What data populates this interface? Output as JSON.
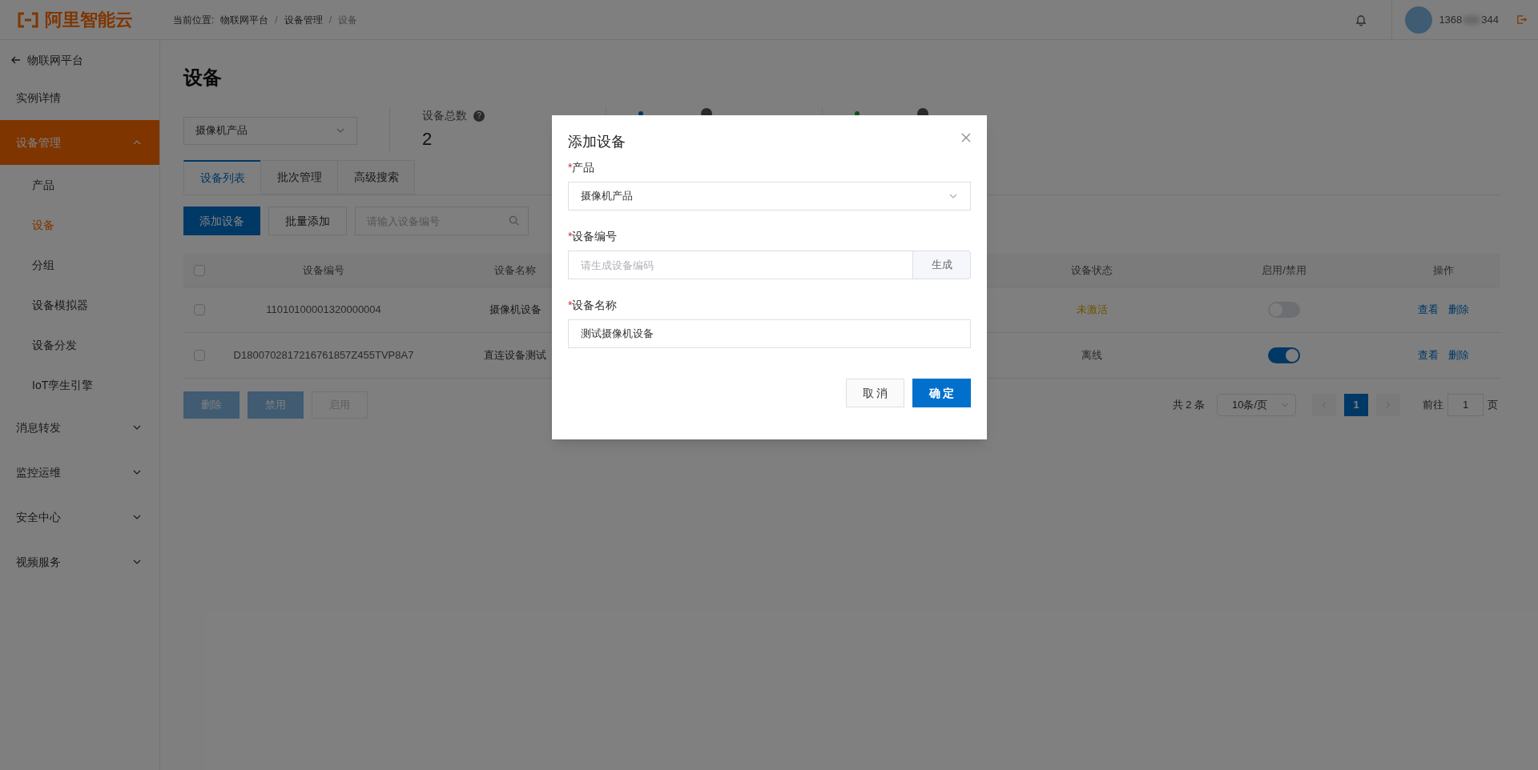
{
  "header": {
    "logo": "阿里智能云",
    "breadcrumb_label": "当前位置:",
    "breadcrumb": [
      "物联网平台",
      "设备管理",
      "设备"
    ],
    "breadcrumb_separator": "/",
    "user_phone_start": "1368",
    "user_phone_end": "344"
  },
  "sidebar": {
    "back": "物联网平台",
    "items": [
      {
        "label": "实例详情",
        "selected": false
      },
      {
        "label": "设备管理",
        "selected": true,
        "expanded": true,
        "children": [
          {
            "label": "产品",
            "selected": false
          },
          {
            "label": "设备",
            "selected": true
          },
          {
            "label": "分组",
            "selected": false
          },
          {
            "label": "设备模拟器",
            "selected": false
          },
          {
            "label": "设备分发",
            "selected": false
          },
          {
            "label": "IoT孪生引擎",
            "selected": false
          }
        ]
      },
      {
        "label": "消息转发",
        "selected": false,
        "expanded": false
      },
      {
        "label": "监控运维",
        "selected": false,
        "expanded": false
      },
      {
        "label": "安全中心",
        "selected": false,
        "expanded": false
      },
      {
        "label": "视频服务",
        "selected": false,
        "expanded": false
      }
    ]
  },
  "page": {
    "title": "设备",
    "product_select": "摄像机产品",
    "stats": [
      {
        "label": "设备总数",
        "help": "?",
        "value": "2",
        "kind": "total"
      },
      {
        "kind": "activated"
      },
      {
        "kind": "online"
      }
    ],
    "tabs": [
      {
        "label": "设备列表",
        "selected": true
      },
      {
        "label": "批次管理",
        "selected": false
      },
      {
        "label": "高级搜索",
        "selected": false
      }
    ],
    "toolbar": {
      "buttons": [
        {
          "label": "添加设备",
          "kind": "primary"
        },
        {
          "label": "批量添加",
          "kind": "default"
        }
      ],
      "search_placeholder": "请输入设备编号"
    },
    "table": {
      "header_checked": false,
      "columns": [
        "设备编号",
        "设备名称",
        "设备状态",
        "启用/禁用",
        "操作"
      ],
      "rows": [
        {
          "checked": false,
          "id": "11010100001320000004",
          "name": "摄像机设备",
          "status": "未激活",
          "kind": "inactive",
          "on": false,
          "actions": [
            "查看",
            "删除"
          ]
        },
        {
          "checked": false,
          "id": "D1800702817216761857Z455TVP8A7",
          "name": "直连设备测试",
          "status": "离线",
          "kind": "offline",
          "on": true,
          "actions": [
            "查看",
            "删除"
          ]
        }
      ]
    },
    "bulk_buttons": [
      {
        "label": "删除",
        "kind": "primary",
        "disabled": true
      },
      {
        "label": "禁用",
        "kind": "primary",
        "disabled": true
      },
      {
        "label": "启用",
        "kind": "default",
        "disabled": true
      }
    ],
    "pagination": {
      "total": "共 2 条",
      "page_size": "10条/页",
      "pages": [
        {
          "label": "1",
          "selected": true
        }
      ],
      "goto_label": "前往",
      "goto_value": "1",
      "goto_suffix": "页"
    }
  },
  "dialog": {
    "title": "添加设备",
    "required_mark": "*",
    "fields": [
      {
        "kind": "select",
        "label": "产品",
        "required": true,
        "value": "摄像机产品"
      },
      {
        "kind": "generate",
        "label": "设备编号",
        "required": true,
        "placeholder": "请生成设备编码",
        "addon": "生成"
      },
      {
        "kind": "input",
        "label": "设备名称",
        "required": true,
        "value": "测试摄像机设备"
      }
    ],
    "buttons": [
      {
        "label": "取 消",
        "kind": "default"
      },
      {
        "label": "确 定",
        "kind": "primary"
      }
    ]
  }
}
